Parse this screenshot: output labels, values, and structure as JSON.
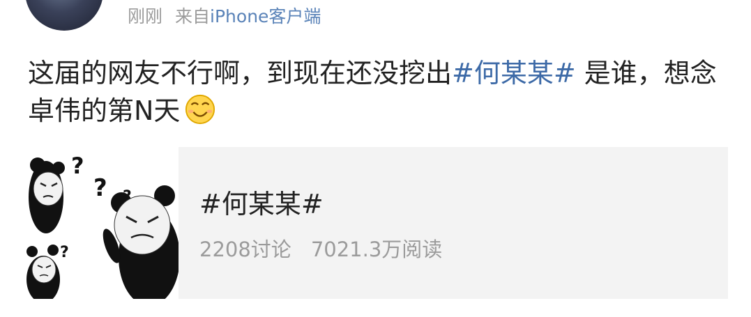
{
  "header": {
    "time": "刚刚",
    "source_prefix": "来自",
    "source_device": "iPhone客户端"
  },
  "post": {
    "text_before_topic": "这届的网友不行啊，到现在还没挖出",
    "topic": "#何某某#",
    "text_after_topic": " 是谁，想念卓伟的第N天",
    "emoji": "smiley-face-icon"
  },
  "topic_card": {
    "title": "#何某某#",
    "discussions": "2208讨论",
    "reads": "7021.3万阅读",
    "thumbnail": "confused-panda-meme-image"
  },
  "colors": {
    "topic_link": "#3d6aa7",
    "meta_gray": "#9b9b9b",
    "card_bg": "#f3f3f3"
  }
}
